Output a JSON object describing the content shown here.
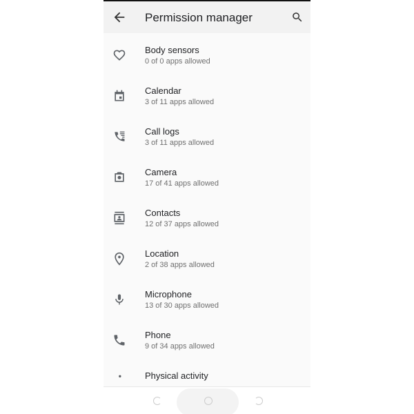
{
  "header": {
    "title": "Permission manager"
  },
  "permissions": [
    {
      "label": "Body sensors",
      "status": "0 of 0 apps allowed",
      "icon": "heart-icon"
    },
    {
      "label": "Calendar",
      "status": "3 of 11 apps allowed",
      "icon": "calendar-icon"
    },
    {
      "label": "Call logs",
      "status": "3 of 11 apps allowed",
      "icon": "call-log-icon"
    },
    {
      "label": "Camera",
      "status": "17 of 41 apps allowed",
      "icon": "camera-icon"
    },
    {
      "label": "Contacts",
      "status": "12 of 37 apps allowed",
      "icon": "contacts-icon"
    },
    {
      "label": "Location",
      "status": "2 of 38 apps allowed",
      "icon": "location-icon"
    },
    {
      "label": "Microphone",
      "status": "13 of 30 apps allowed",
      "icon": "microphone-icon"
    },
    {
      "label": "Phone",
      "status": "9 of 34 apps allowed",
      "icon": "phone-icon"
    },
    {
      "label": "Physical activity",
      "status": "",
      "icon": "activity-icon"
    }
  ]
}
